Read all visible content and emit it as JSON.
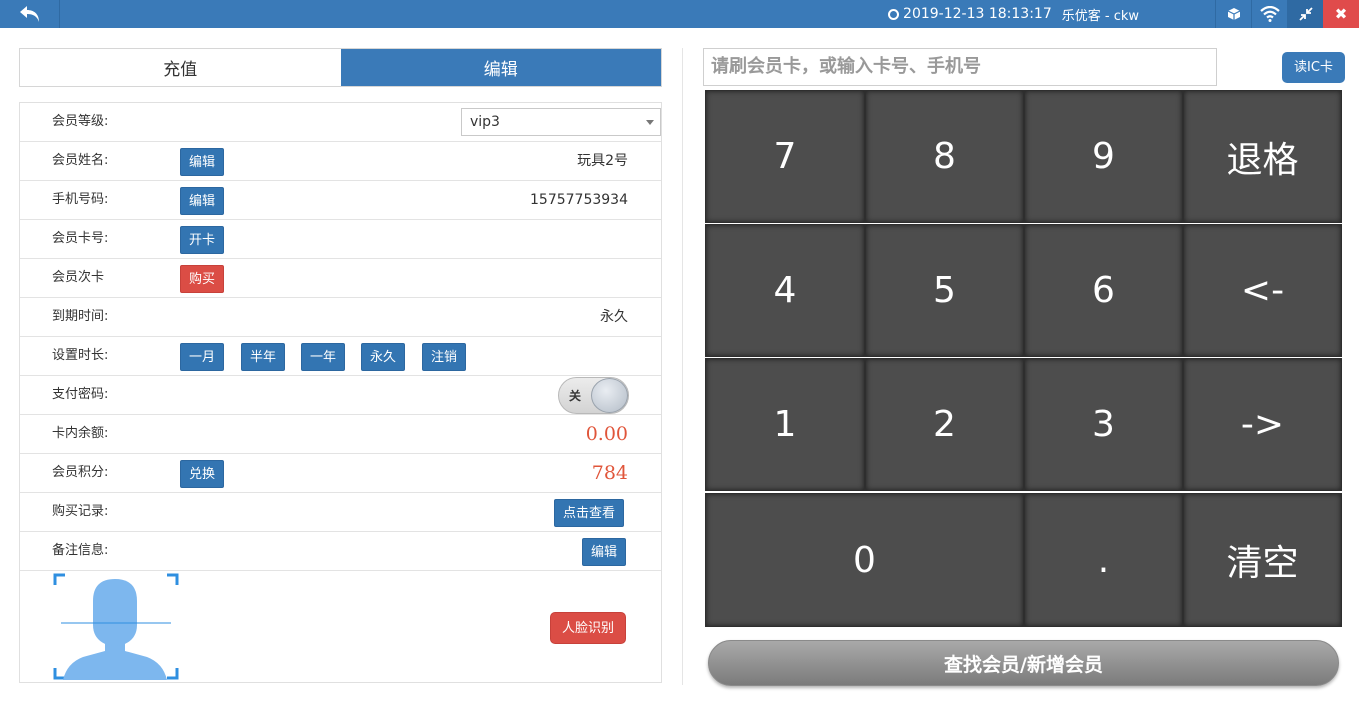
{
  "topbar": {
    "datetime": "2019-12-13 18:13:17",
    "user": "乐优客 - ckw",
    "icons": [
      "back-icon",
      "clock-icon",
      "cube-icon",
      "wifi-icon",
      "compress-icon",
      "close-icon"
    ],
    "close_label": "✖"
  },
  "tabs": [
    {
      "label": "充值",
      "active": false
    },
    {
      "label": "编辑",
      "active": true
    }
  ],
  "form": {
    "level": {
      "label": "会员等级:",
      "value": "vip3"
    },
    "name": {
      "label": "会员姓名:",
      "button": "编辑",
      "value": "玩具2号"
    },
    "phone": {
      "label": "手机号码:",
      "button": "编辑",
      "value": "15757753934"
    },
    "card": {
      "label": "会员卡号:",
      "button": "开卡"
    },
    "times_card": {
      "label": "会员次卡",
      "button": "购买"
    },
    "expiry": {
      "label": "到期时间:",
      "value": "永久"
    },
    "duration": {
      "label": "设置时长:",
      "buttons": [
        "一月",
        "半年",
        "一年",
        "永久",
        "注销"
      ]
    },
    "pay_password": {
      "label": "支付密码:",
      "toggle_label": "关"
    },
    "balance": {
      "label": "卡内余额:",
      "value": "0.00"
    },
    "points": {
      "label": "会员积分:",
      "button": "兑换",
      "value": "784"
    },
    "purchases": {
      "label": "购买记录:",
      "button": "点击查看"
    },
    "notes": {
      "label": "备注信息:",
      "button": "编辑"
    },
    "face_button": "人脸识别"
  },
  "search": {
    "placeholder": "请刷会员卡，或输入卡号、手机号"
  },
  "ic_button": "读IC卡",
  "keypad": {
    "keys": [
      "7",
      "8",
      "9",
      "退格",
      "4",
      "5",
      "6",
      "<-",
      "1",
      "2",
      "3",
      "->",
      "0",
      ".",
      "清空"
    ]
  },
  "submit_label": "查找会员/新增会员",
  "colors": {
    "primary": "#3a7ab8",
    "danger": "#db4d45",
    "keypad": "#4d4d4d",
    "value_red": "#e0553a"
  }
}
